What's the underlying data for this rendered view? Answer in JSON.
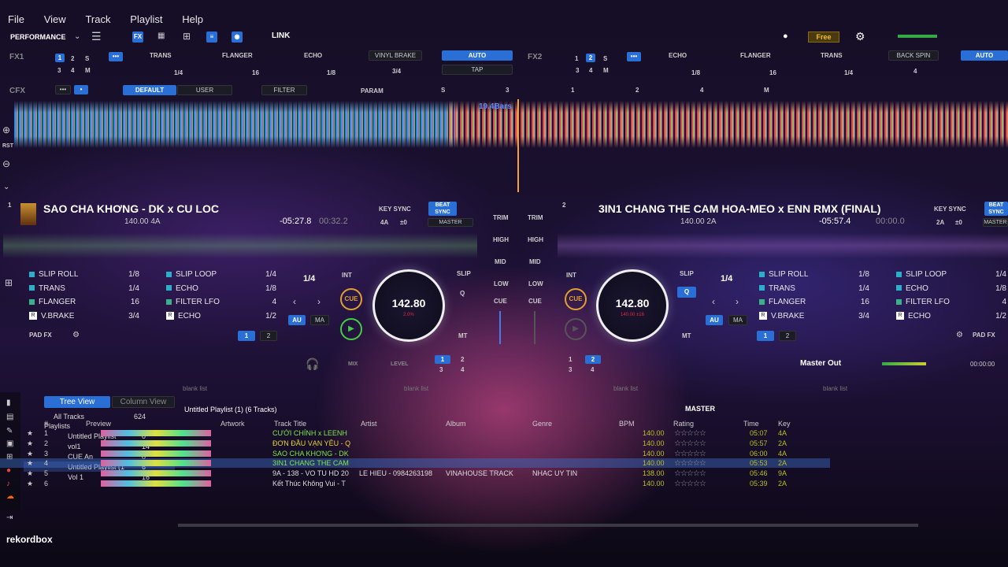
{
  "menu": [
    "File",
    "View",
    "Track",
    "Playlist",
    "Help"
  ],
  "toolbar": {
    "mode": "PERFORMANCE",
    "link": "LINK",
    "free": "Free"
  },
  "fx1": {
    "label": "FX1",
    "n": [
      "1",
      "2",
      "S",
      "3",
      "4",
      "M"
    ],
    "effects": [
      "TRANS",
      "FLANGER",
      "ECHO"
    ],
    "beats": [
      "1/4",
      "16",
      "1/8"
    ],
    "brake": "VINYL BRAKE",
    "brake_beat": "3/4",
    "auto": "AUTO",
    "tap": "TAP"
  },
  "fx2": {
    "label": "FX2",
    "n": [
      "1",
      "2",
      "S",
      "3",
      "4",
      "M"
    ],
    "effects": [
      "ECHO",
      "FLANGER",
      "TRANS"
    ],
    "beats": [
      "1/8",
      "16",
      "1/4"
    ],
    "brake": "BACK SPIN",
    "brake_beat": "4",
    "auto": "AUTO"
  },
  "cfx": {
    "label": "CFX",
    "default": "DEFAULT",
    "user": "USER",
    "filter": "FILTER",
    "param": "PARAM",
    "marks": [
      "S",
      "3",
      "1",
      "2",
      "4",
      "M"
    ]
  },
  "overview": {
    "bars": "19.4Bars",
    "rst": "RST"
  },
  "deck1": {
    "num": "1",
    "title": "SAO CHA KHƠNG - DK x CU LOC",
    "bpm_key": "140.00 4A",
    "remain": "-05:27.8",
    "elapsed": "00:32.2",
    "keysync": "KEY SYNC",
    "key": "4A",
    "shift": "±0",
    "beatsync": "BEAT SYNC",
    "master": "MASTER",
    "beat": "1/4",
    "int": "INT",
    "cue": "CUE",
    "au": "AU",
    "ma": "MA",
    "jog_bpm": "142.80",
    "jog_pct": "2.0%",
    "slip": "SLIP",
    "q": "Q",
    "mt": "MT",
    "padfx": "PAD FX",
    "page": [
      "1",
      "2"
    ],
    "pads": [
      {
        "name": "SLIP ROLL",
        "v": "1/8",
        "c": "#2ab0c8"
      },
      {
        "name": "TRANS",
        "v": "1/4",
        "c": "#2ab0c8"
      },
      {
        "name": "FLANGER",
        "v": "16",
        "c": "#3bb08c"
      },
      {
        "name": "V.BRAKE",
        "v": "3/4",
        "c": "#3a5ad8",
        "r": "R"
      },
      {
        "name": "SLIP LOOP",
        "v": "1/4",
        "c": "#2ab0c8"
      },
      {
        "name": "ECHO",
        "v": "1/8",
        "c": "#2ab0c8"
      },
      {
        "name": "FILTER LFO",
        "v": "4",
        "c": "#3bb08c"
      },
      {
        "name": "ECHO",
        "v": "1/2",
        "c": "#3a5ad8",
        "r": "R"
      }
    ]
  },
  "deck2": {
    "num": "2",
    "title": "3IN1 CHANG THE CAM HOA-MEO x ENN RMX (FINAL)",
    "bpm_key": "140.00 2A",
    "remain": "-05:57.4",
    "elapsed": "00:00.0",
    "keysync": "KEY SYNC",
    "key": "2A",
    "shift": "±0",
    "beatsync": "BEAT SYNC",
    "master": "MASTER",
    "beat": "1/4",
    "int": "INT",
    "cue": "CUE",
    "au": "AU",
    "ma": "MA",
    "jog_bpm": "142.80",
    "jog_pct": "140.00 ±16",
    "slip": "SLIP",
    "q": "Q",
    "mt": "MT",
    "padfx": "PAD FX",
    "page": [
      "1",
      "2"
    ],
    "pads": [
      {
        "name": "SLIP ROLL",
        "v": "1/8",
        "c": "#2ab0c8"
      },
      {
        "name": "TRANS",
        "v": "1/4",
        "c": "#2ab0c8"
      },
      {
        "name": "FLANGER",
        "v": "16",
        "c": "#3bb08c"
      },
      {
        "name": "V.BRAKE",
        "v": "3/4",
        "c": "#3a5ad8",
        "r": "R"
      },
      {
        "name": "SLIP LOOP",
        "v": "1/4",
        "c": "#2ab0c8"
      },
      {
        "name": "ECHO",
        "v": "1/8",
        "c": "#2ab0c8"
      },
      {
        "name": "FILTER LFO",
        "v": "4",
        "c": "#3bb08c"
      },
      {
        "name": "ECHO",
        "v": "1/2",
        "c": "#3a5ad8",
        "r": "R"
      }
    ]
  },
  "mixer": {
    "trim": "TRIM",
    "high": "HIGH",
    "mid": "MID",
    "low": "LOW",
    "cue": "CUE",
    "mix": "MIX",
    "level": "LEVEL",
    "master_out": "Master Out",
    "time": "00:00:00",
    "dc": [
      "1",
      "2",
      "3",
      "4"
    ]
  },
  "browser": {
    "blank": "blank list",
    "playlist_title": "Untitled Playlist (1) (6 Tracks)",
    "master": "MASTER",
    "tree_view": "Tree View",
    "column_view": "Column View",
    "tree": [
      {
        "name": "All Tracks",
        "count": "624"
      },
      {
        "name": "Playlists",
        "count": ""
      },
      {
        "name": "Untitled Playlist",
        "count": "0"
      },
      {
        "name": "vol1",
        "count": "14"
      },
      {
        "name": "CUE An",
        "count": "0"
      },
      {
        "name": "Untitled Playlist (1",
        "count": "6"
      },
      {
        "name": "Vol 1",
        "count": "16"
      }
    ],
    "columns": [
      "#",
      "Preview",
      "Artwork",
      "Track Title",
      "Artist",
      "Album",
      "Genre",
      "BPM",
      "Rating",
      "Time",
      "Key"
    ],
    "rows": [
      {
        "n": "1",
        "title": "CƯỚI CHỈNH x LEENH",
        "artist": "",
        "album": "",
        "genre": "",
        "bpm": "140.00",
        "time": "05:07",
        "key": "4A"
      },
      {
        "n": "2",
        "title": "ĐƠN ĐẦU VẠN YÊU - Q",
        "artist": "",
        "album": "",
        "genre": "",
        "bpm": "140.00",
        "time": "05:57",
        "key": "2A"
      },
      {
        "n": "3",
        "title": "SAO CHA KHƠNG - DK",
        "artist": "",
        "album": "",
        "genre": "",
        "bpm": "140.00",
        "time": "06:00",
        "key": "4A"
      },
      {
        "n": "4",
        "title": "3IN1 CHANG THE CAM",
        "artist": "",
        "album": "",
        "genre": "",
        "bpm": "140.00",
        "time": "05:53",
        "key": "2A"
      },
      {
        "n": "5",
        "title": "9A - 138 - VO TU HD 20",
        "artist": "LE HIEU - 0984263198",
        "album": "VINAHOUSE TRACK",
        "genre": "NHAC UY TIN",
        "bpm": "138.00",
        "time": "05:46",
        "key": "9A"
      },
      {
        "n": "6",
        "title": "Kết Thúc Không Vui - T",
        "artist": "",
        "album": "",
        "genre": "",
        "bpm": "140.00",
        "time": "05:39",
        "key": "2A"
      }
    ]
  },
  "brand": "rekordbox"
}
